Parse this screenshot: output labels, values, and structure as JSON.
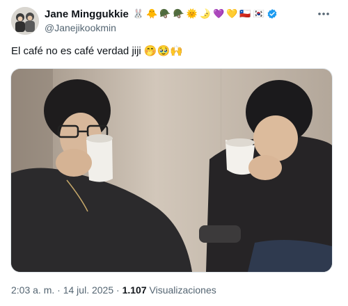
{
  "author": {
    "display_name": "Jane Minggukkie",
    "handle": "@Janejikookmin",
    "name_emojis": [
      "🐰",
      "🐥",
      "🪖",
      "🪖",
      "🌞",
      "🌛",
      "💜",
      "💛",
      "🇨🇱",
      "🇰🇷"
    ],
    "verified": true,
    "verified_color": "#1d9bf0"
  },
  "tweet": {
    "text": "El café no es café verdad jiji 🤭🥹🙌"
  },
  "meta": {
    "time": "2:03 a. m.",
    "separator": "·",
    "date": "14 jul. 2025",
    "views_count": "1.107",
    "views_label": "Visualizaciones"
  },
  "icons": {
    "more": "more-horizontal-icon",
    "verified": "verified-badge-icon"
  }
}
